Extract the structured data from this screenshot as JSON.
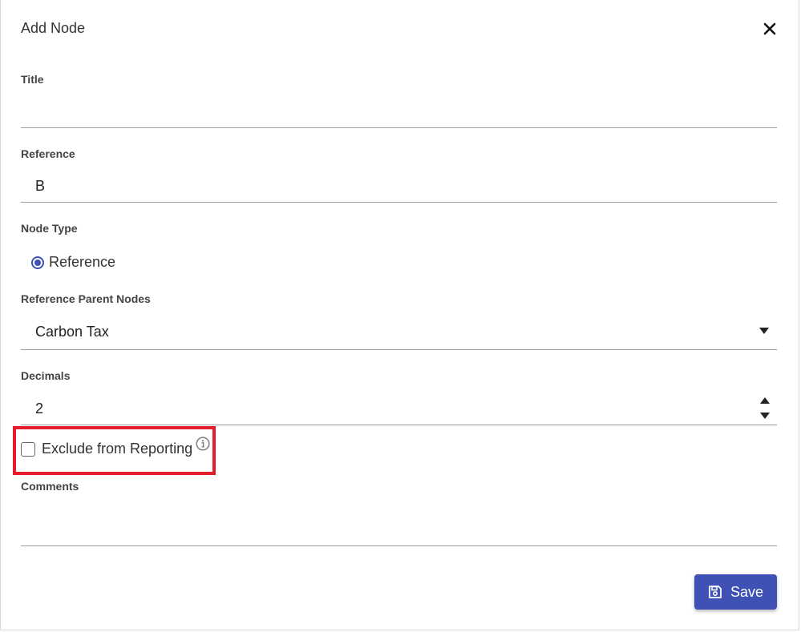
{
  "dialog": {
    "title": "Add Node",
    "close_icon": "close-icon"
  },
  "fields": {
    "title": {
      "label": "Title",
      "value": ""
    },
    "reference": {
      "label": "Reference",
      "value": "B"
    },
    "node_type": {
      "label": "Node Type",
      "option": "Reference",
      "selected": true
    },
    "reference_parent_nodes": {
      "label": "Reference Parent Nodes",
      "value": "Carbon Tax"
    },
    "decimals": {
      "label": "Decimals",
      "value": "2"
    },
    "exclude_from_reporting": {
      "label": "Exclude from Reporting",
      "checked": false,
      "info_icon": "info-icon"
    },
    "comments": {
      "label": "Comments",
      "value": ""
    }
  },
  "actions": {
    "save_label": "Save",
    "save_icon": "floppy-disk-icon"
  },
  "colors": {
    "primary": "#3f51b5",
    "highlight": "#e31e2a"
  }
}
